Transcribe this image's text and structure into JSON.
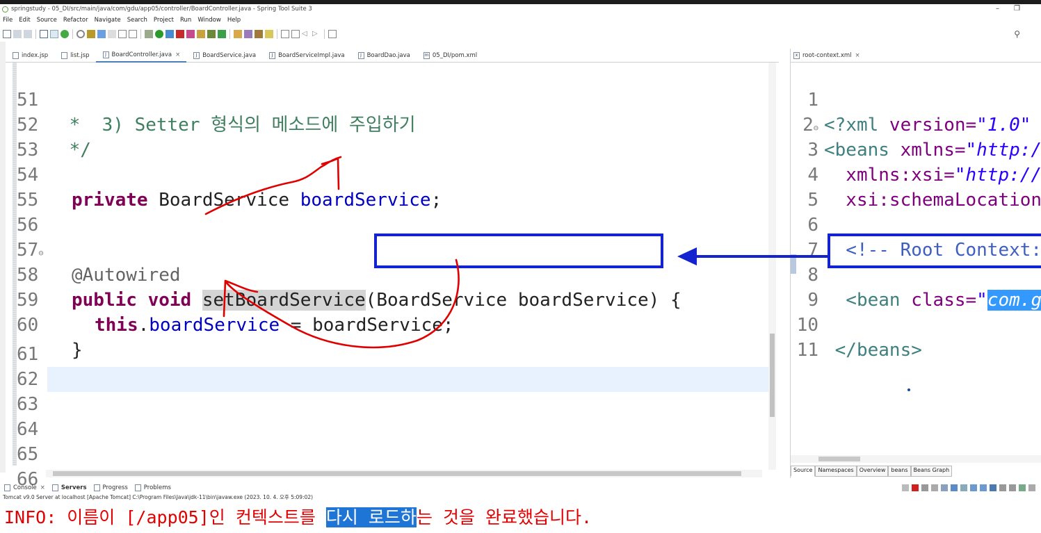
{
  "window": {
    "title": "springstudy - 05_DI/src/main/java/com/gdu/app05/controller/BoardController.java - Spring Tool Suite 3",
    "minimize_glyph": "–",
    "restore_glyph": "❐"
  },
  "menu": [
    "File",
    "Edit",
    "Source",
    "Refactor",
    "Navigate",
    "Search",
    "Project",
    "Run",
    "Window",
    "Help"
  ],
  "editor_tabs": [
    {
      "label": "index.jsp",
      "icon": "jsp-file-icon",
      "active": false
    },
    {
      "label": "list.jsp",
      "icon": "jsp-file-icon",
      "active": false
    },
    {
      "label": "BoardController.java",
      "icon": "java-file-icon",
      "active": true,
      "close": "×"
    },
    {
      "label": "BoardService.java",
      "icon": "java-file-icon",
      "active": false
    },
    {
      "label": "BoardServiceImpl.java",
      "icon": "java-file-icon",
      "active": false
    },
    {
      "label": "BoardDao.java",
      "icon": "java-file-icon",
      "active": false
    },
    {
      "label": "05_DI/pom.xml",
      "icon": "maven-file-icon",
      "active": false
    }
  ],
  "code": {
    "l51": {
      "num": "51",
      "text": " *  3) Setter 형식의 메소드에 주입하기"
    },
    "l52": {
      "num": "52",
      "text": " */"
    },
    "l53": {
      "num": "53"
    },
    "l54": {
      "num": "54",
      "kw": "private",
      "rest1": " BoardService ",
      "field": "boardService",
      "rest2": ";"
    },
    "l55": {
      "num": "55"
    },
    "l56": {
      "num": "56"
    },
    "l57": {
      "num": "57",
      "fold": "⊖",
      "text": "@Autowired"
    },
    "l58": {
      "num": "58",
      "kw1": "public",
      "kw2": "void",
      "method": "setBoardService",
      "params": "(BoardService boardService) {"
    },
    "l59": {
      "num": "59",
      "kw": "this",
      "dot": ".",
      "field": "boardService",
      "rest": " = boardService;"
    },
    "l60": {
      "num": "60",
      "text": "}"
    },
    "l61": {
      "num": "61"
    },
    "l62": {
      "num": "62"
    },
    "l63": {
      "num": "63"
    },
    "l64": {
      "num": "64"
    },
    "l65": {
      "num": "65"
    },
    "l66": {
      "num": "66"
    }
  },
  "xml_tab": {
    "label": "root-context.xml",
    "close": "×"
  },
  "xml": {
    "l1": {
      "num": "1",
      "open": "<?",
      "tag": "xml",
      "attr": " version=",
      "val": "\"1.0\""
    },
    "l2": {
      "num": "2",
      "fold": "⊖",
      "open": "<",
      "tag": "beans",
      "attr": " xmlns=",
      "val": "\"http:/"
    },
    "l3": {
      "num": "3",
      "attr": "  xmlns:xsi=",
      "val": "\"http://"
    },
    "l4": {
      "num": "4",
      "attr": "  xsi:schemaLocation"
    },
    "l5": {
      "num": "5"
    },
    "l6": {
      "num": "6",
      "text": "  <!-- Root Context:"
    },
    "l7": {
      "num": "7"
    },
    "l8": {
      "num": "8",
      "open": "  <",
      "tag": "bean",
      "attr": " class=",
      "quote": "\"",
      "sel": "com.g"
    },
    "l9": {
      "num": "9"
    },
    "l10": {
      "num": "10",
      "text": " </beans>"
    },
    "l11": {
      "num": "11"
    }
  },
  "xml_bottom_tabs": [
    "Source",
    "Namespaces",
    "Overview",
    "beans",
    "Beans Graph"
  ],
  "console": {
    "tabs": [
      {
        "label": "Console",
        "icon": "console-icon",
        "close": "×"
      },
      {
        "label": "Servers",
        "icon": "servers-icon",
        "active": true
      },
      {
        "label": "Progress",
        "icon": "progress-icon"
      },
      {
        "label": "Problems",
        "icon": "problems-icon"
      }
    ],
    "status": "Tomcat v9.0 Server at localhost [Apache Tomcat] C:\\Program Files\\Java\\jdk-11\\bin\\javaw.exe  (2023. 10. 4. 오후 5:09:02)",
    "output_before": "INFO: 이름이 [/app05]인 컨텍스트를 ",
    "output_selected": "다시 로드하",
    "output_after": "는 것을 완료했습니다."
  },
  "colors": {
    "annotation_blue": "#1423d0",
    "annotation_red": "#e00000",
    "console_red": "#e20000"
  }
}
